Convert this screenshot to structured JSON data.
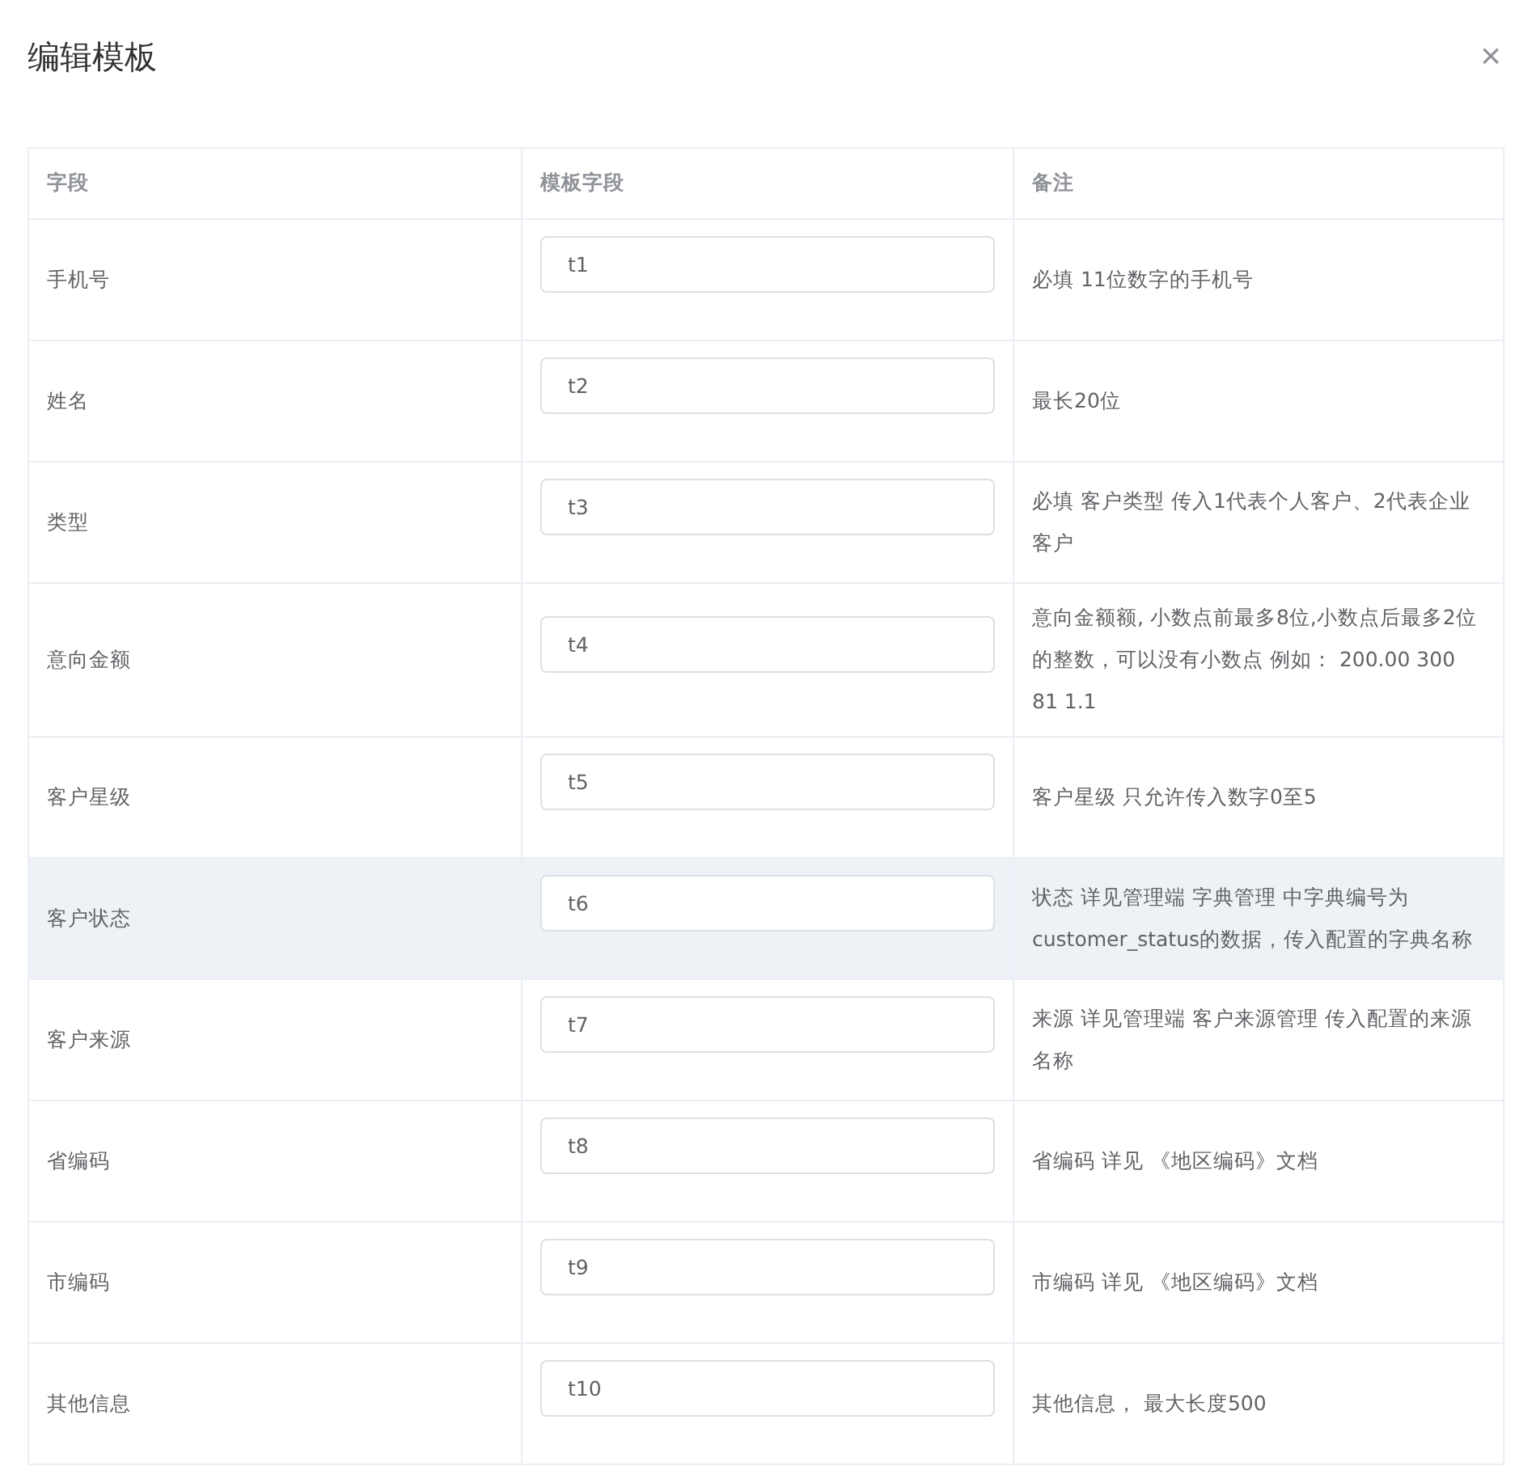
{
  "dialog": {
    "title": "编辑模板",
    "close": "×"
  },
  "table": {
    "columns": [
      "字段",
      "模板字段",
      "备注"
    ],
    "rows": [
      {
        "field": "手机号",
        "value": "t1",
        "note": "必填 11位数字的手机号",
        "hovered": false
      },
      {
        "field": "姓名",
        "value": "t2",
        "note": "最长20位",
        "hovered": false
      },
      {
        "field": "类型",
        "value": "t3",
        "note": "必填 客户类型 传入1代表个人客户、2代表企业客户",
        "hovered": false
      },
      {
        "field": "意向金额",
        "value": "t4",
        "note": "意向金额额, 小数点前最多8位,小数点后最多2位的整数，可以没有小数点 例如： 200.00 300 81 1.1",
        "hovered": false
      },
      {
        "field": "客户星级",
        "value": "t5",
        "note": "客户星级 只允许传入数字0至5",
        "hovered": false
      },
      {
        "field": "客户状态",
        "value": "t6",
        "note": "状态 详见管理端 字典管理 中字典编号为customer_status的数据，传入配置的字典名称",
        "hovered": true
      },
      {
        "field": "客户来源",
        "value": "t7",
        "note": "来源 详见管理端 客户来源管理 传入配置的来源名称",
        "hovered": false
      },
      {
        "field": "省编码",
        "value": "t8",
        "note": "省编码 详见 《地区编码》文档",
        "hovered": false
      },
      {
        "field": "市编码",
        "value": "t9",
        "note": "市编码 详见 《地区编码》文档",
        "hovered": false
      },
      {
        "field": "其他信息",
        "value": "t10",
        "note": "其他信息，  最大长度500",
        "hovered": false
      }
    ]
  }
}
